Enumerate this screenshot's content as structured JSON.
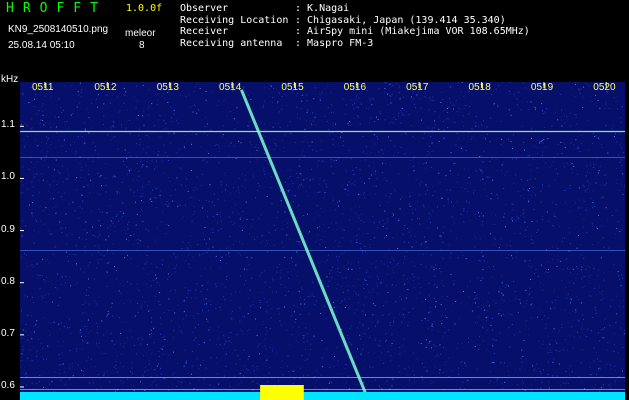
{
  "header": {
    "brand": "HROFFT",
    "version": "1.0.0f",
    "filename": "KN9_2508140510.png",
    "mode": "meleor",
    "datetime": "25.08.14 05:10",
    "count": "8"
  },
  "info": [
    {
      "key": "Observer",
      "value": ": K.Nagai"
    },
    {
      "key": "Receiving Location",
      "value": ": Chigasaki, Japan (139.414 35.340)"
    },
    {
      "key": "Receiver",
      "value": ": AirSpy mini (Miakejima VOR 108.65MHz)"
    },
    {
      "key": "Receiving antenna",
      "value": ": Maspro FM-3"
    }
  ],
  "colors": {
    "background": "#000000",
    "plot_background": "#06106a",
    "brand": "#00ff00",
    "version": "#ffff00",
    "time_labels": "#ffff66",
    "carrier_line": "#9cff9c",
    "meteor_echo": "#80ffd0",
    "noise_floor": "#00e5ff",
    "burst": "#ffff00"
  },
  "chart_data": {
    "type": "heatmap",
    "ylabel": "kHz",
    "y_ticks": [
      "1.1",
      "1.0",
      "0.9",
      "0.8",
      "0.7",
      "0.6"
    ],
    "y_tick_values": [
      1.1,
      1.0,
      0.9,
      0.8,
      0.7,
      0.6
    ],
    "ylim": [
      0.575,
      1.185
    ],
    "x_ticks": [
      "0511",
      "0512",
      "0513",
      "0514",
      "0515",
      "0516",
      "0517",
      "0518",
      "0519",
      "0520"
    ],
    "x_tick_values": [
      511,
      512,
      513,
      514,
      515,
      516,
      517,
      518,
      519,
      520
    ],
    "xlim": [
      510.6,
      520.3
    ],
    "carriers_khz": [
      1.09,
      1.04,
      0.862,
      0.618,
      0.595
    ],
    "meteor_echo": {
      "start": [
        514.15,
        1.17
      ],
      "end": [
        516.15,
        0.585
      ]
    },
    "burst_range": [
      514.45,
      515.15
    ]
  }
}
